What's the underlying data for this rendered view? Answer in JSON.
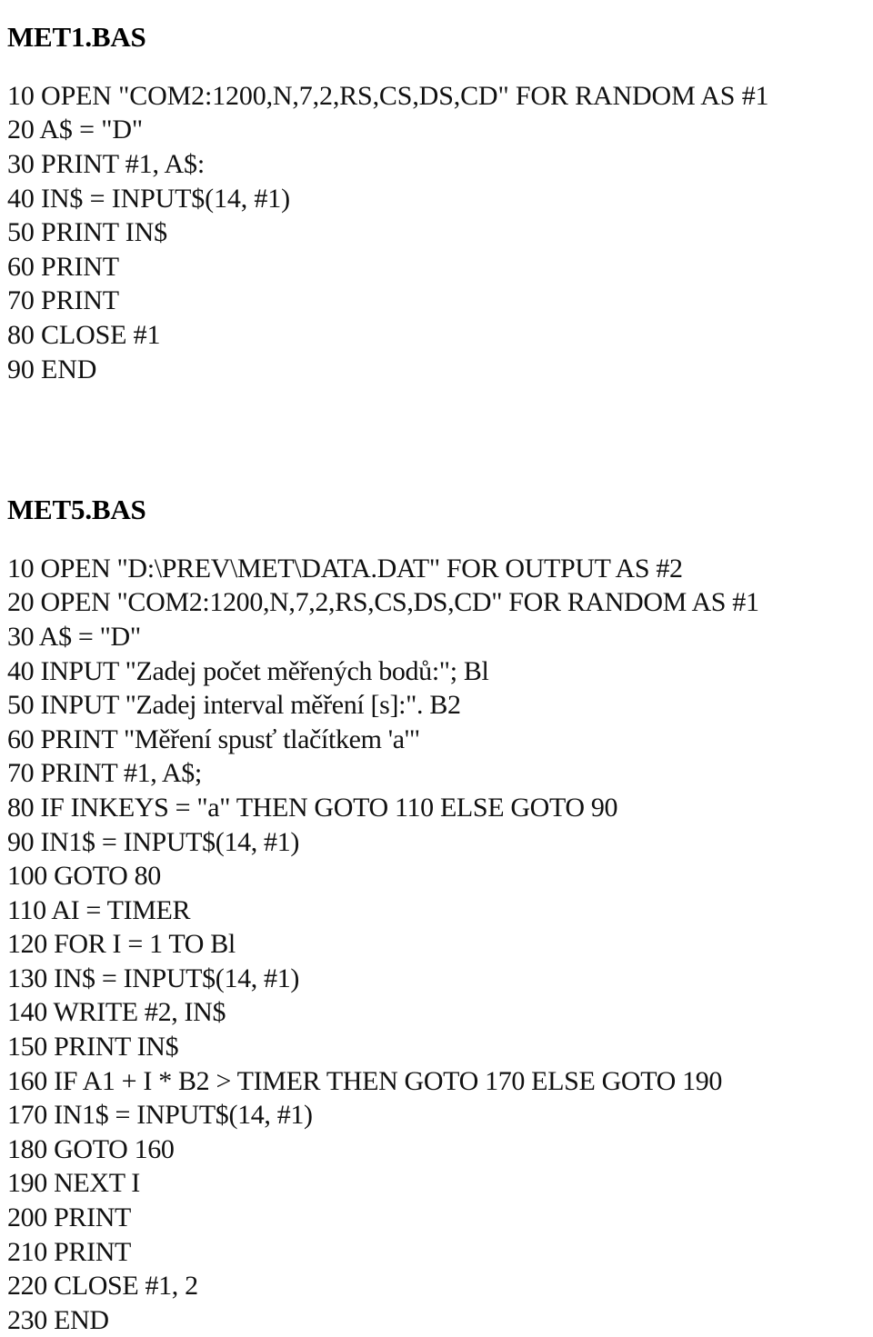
{
  "document": {
    "page_background": "#ffffff",
    "text_color": "#111111"
  },
  "programs": [
    {
      "title": "MET1.BAS",
      "lines": [
        "10 OPEN \"COM2:1200,N,7,2,RS,CS,DS,CD\" FOR RANDOM AS #1",
        "20 A$ = \"D\"",
        "30 PRINT #1, A$:",
        "40 IN$ = INPUT$(14, #1)",
        "50 PRINT IN$",
        "60 PRINT",
        "70 PRINT",
        "80 CLOSE #1",
        "90 END"
      ]
    },
    {
      "title": "MET5.BAS",
      "lines": [
        "10 OPEN \"D:\\PREV\\MET\\DATA.DAT\" FOR OUTPUT AS #2",
        "20 OPEN \"COM2:1200,N,7,2,RS,CS,DS,CD\" FOR RANDOM AS #1",
        "30 A$ = \"D\"",
        "40 INPUT \"Zadej počet měřených bodů:\"; Bl",
        "50 INPUT \"Zadej interval měření [s]:\". B2",
        "60 PRINT \"Měření spusť tlačítkem 'a'\"",
        "70 PRINT #1, A$;",
        "80 IF INKEYS = \"a\" THEN GOTO 110 ELSE GOTO 90",
        "90 IN1$ = INPUT$(14, #1)",
        "100 GOTO 80",
        "110 AI = TIMER",
        "120 FOR I = 1 TO Bl",
        "130 IN$ = INPUT$(14, #1)",
        "140 WRITE #2, IN$",
        "150 PRINT IN$",
        "160 IF A1 + I * B2 > TIMER THEN GOTO 170 ELSE GOTO 190",
        "170 IN1$ = INPUT$(14, #1)",
        "180 GOTO 160",
        "190 NEXT I",
        "200 PRINT",
        "210 PRINT",
        "220 CLOSE #1, 2",
        "230 END"
      ]
    }
  ]
}
